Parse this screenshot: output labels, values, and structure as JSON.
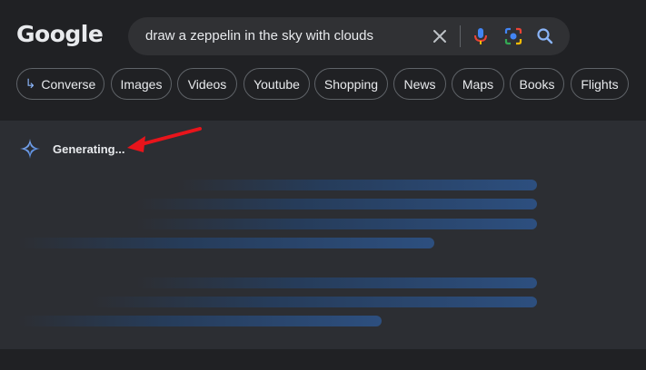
{
  "header": {
    "logo_text": "Google"
  },
  "search": {
    "query": "draw a zeppelin in the sky with clouds",
    "icons": [
      "close-icon",
      "mic-icon",
      "lens-icon",
      "search-icon"
    ]
  },
  "chips": [
    {
      "label": "Converse",
      "icon": "reply-arrow-icon"
    },
    {
      "label": "Images"
    },
    {
      "label": "Videos"
    },
    {
      "label": "Youtube"
    },
    {
      "label": "Shopping"
    },
    {
      "label": "News"
    },
    {
      "label": "Maps"
    },
    {
      "label": "Books"
    },
    {
      "label": "Flights"
    }
  ],
  "ai_overview": {
    "status_text": "Generating...",
    "icon": "gemini-spark-icon"
  },
  "colors": {
    "background": "#202124",
    "panel": "#2c2e33",
    "accent_blue": "#8ab4f8",
    "arrow_red": "#e8141b"
  }
}
